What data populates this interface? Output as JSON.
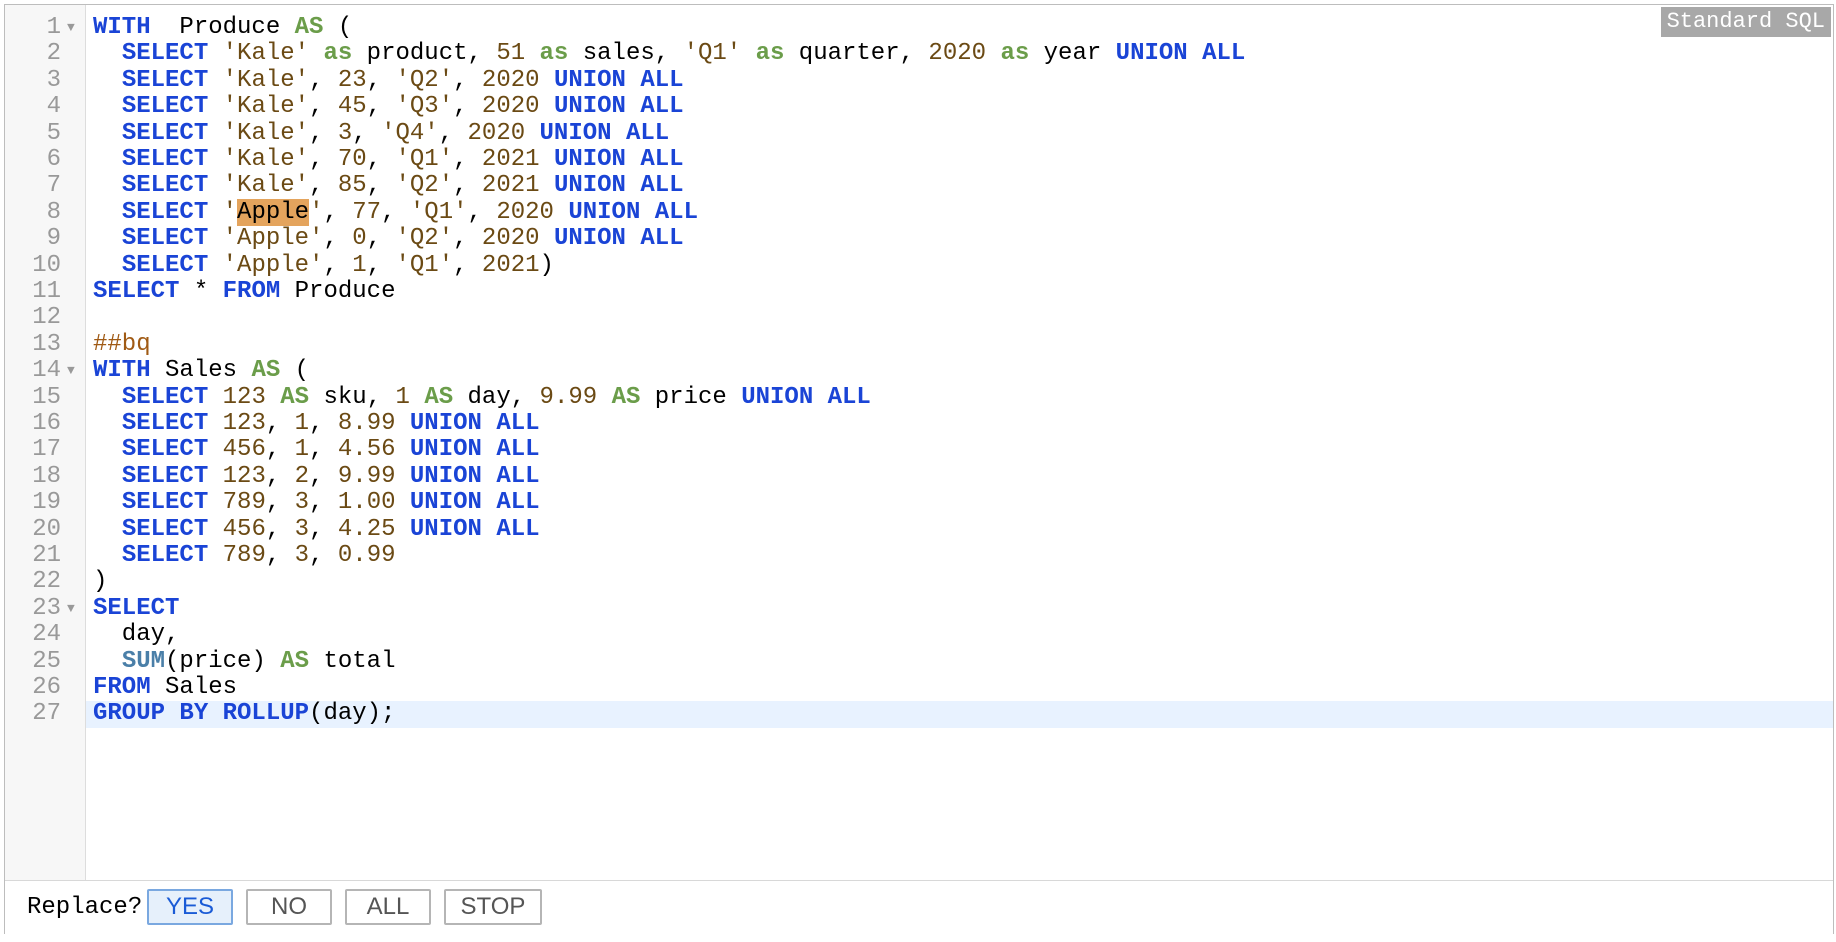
{
  "editor": {
    "dialect_label": "Standard SQL",
    "lines": [
      {
        "n": "1",
        "fold": true,
        "tokens": [
          [
            "kw",
            "WITH"
          ],
          [
            "",
            "  Produce "
          ],
          [
            "as",
            "AS"
          ],
          [
            "",
            " ("
          ]
        ]
      },
      {
        "n": "2",
        "tokens": [
          [
            "",
            "  "
          ],
          [
            "kw",
            "SELECT"
          ],
          [
            "",
            " "
          ],
          [
            "str",
            "'Kale'"
          ],
          [
            "",
            " "
          ],
          [
            "as",
            "as"
          ],
          [
            "",
            " product, "
          ],
          [
            "num",
            "51"
          ],
          [
            "",
            " "
          ],
          [
            "as",
            "as"
          ],
          [
            "",
            " sales, "
          ],
          [
            "str",
            "'Q1'"
          ],
          [
            "",
            " "
          ],
          [
            "as",
            "as"
          ],
          [
            "",
            " quarter, "
          ],
          [
            "num",
            "2020"
          ],
          [
            "",
            " "
          ],
          [
            "as",
            "as"
          ],
          [
            "",
            " year "
          ],
          [
            "kw",
            "UNION ALL"
          ]
        ]
      },
      {
        "n": "3",
        "tokens": [
          [
            "",
            "  "
          ],
          [
            "kw",
            "SELECT"
          ],
          [
            "",
            " "
          ],
          [
            "str",
            "'Kale'"
          ],
          [
            ", ",
            ", "
          ],
          [
            "num",
            "23"
          ],
          [
            ", ",
            ", "
          ],
          [
            "str",
            "'Q2'"
          ],
          [
            ", ",
            ", "
          ],
          [
            "num",
            "2020"
          ],
          [
            "",
            " "
          ],
          [
            "kw",
            "UNION ALL"
          ]
        ]
      },
      {
        "n": "4",
        "tokens": [
          [
            "",
            "  "
          ],
          [
            "kw",
            "SELECT"
          ],
          [
            "",
            " "
          ],
          [
            "str",
            "'Kale'"
          ],
          [
            ", ",
            ", "
          ],
          [
            "num",
            "45"
          ],
          [
            ", ",
            ", "
          ],
          [
            "str",
            "'Q3'"
          ],
          [
            ", ",
            ", "
          ],
          [
            "num",
            "2020"
          ],
          [
            "",
            " "
          ],
          [
            "kw",
            "UNION ALL"
          ]
        ]
      },
      {
        "n": "5",
        "tokens": [
          [
            "",
            "  "
          ],
          [
            "kw",
            "SELECT"
          ],
          [
            "",
            " "
          ],
          [
            "str",
            "'Kale'"
          ],
          [
            ", ",
            ", "
          ],
          [
            "num",
            "3"
          ],
          [
            ", ",
            ", "
          ],
          [
            "str",
            "'Q4'"
          ],
          [
            ", ",
            ", "
          ],
          [
            "num",
            "2020"
          ],
          [
            "",
            " "
          ],
          [
            "kw",
            "UNION ALL"
          ]
        ]
      },
      {
        "n": "6",
        "tokens": [
          [
            "",
            "  "
          ],
          [
            "kw",
            "SELECT"
          ],
          [
            "",
            " "
          ],
          [
            "str",
            "'Kale'"
          ],
          [
            ", ",
            ", "
          ],
          [
            "num",
            "70"
          ],
          [
            ", ",
            ", "
          ],
          [
            "str",
            "'Q1'"
          ],
          [
            ", ",
            ", "
          ],
          [
            "num",
            "2021"
          ],
          [
            "",
            " "
          ],
          [
            "kw",
            "UNION ALL"
          ]
        ]
      },
      {
        "n": "7",
        "tokens": [
          [
            "",
            "  "
          ],
          [
            "kw",
            "SELECT"
          ],
          [
            "",
            " "
          ],
          [
            "str",
            "'Kale'"
          ],
          [
            ", ",
            ", "
          ],
          [
            "num",
            "85"
          ],
          [
            ", ",
            ", "
          ],
          [
            "str",
            "'Q2'"
          ],
          [
            ", ",
            ", "
          ],
          [
            "num",
            "2021"
          ],
          [
            "",
            " "
          ],
          [
            "kw",
            "UNION ALL"
          ]
        ]
      },
      {
        "n": "8",
        "tokens": [
          [
            "",
            "  "
          ],
          [
            "kw",
            "SELECT"
          ],
          [
            "",
            " "
          ],
          [
            "str",
            "'"
          ],
          [
            "hl",
            "Apple"
          ],
          [
            "str",
            "'"
          ],
          [
            ", ",
            ", "
          ],
          [
            "num",
            "77"
          ],
          [
            ", ",
            ", "
          ],
          [
            "str",
            "'Q1'"
          ],
          [
            ", ",
            ", "
          ],
          [
            "num",
            "2020"
          ],
          [
            "",
            " "
          ],
          [
            "kw",
            "UNION ALL"
          ]
        ]
      },
      {
        "n": "9",
        "tokens": [
          [
            "",
            "  "
          ],
          [
            "kw",
            "SELECT"
          ],
          [
            "",
            " "
          ],
          [
            "str",
            "'Apple'"
          ],
          [
            ", ",
            ", "
          ],
          [
            "num",
            "0"
          ],
          [
            ", ",
            ", "
          ],
          [
            "str",
            "'Q2'"
          ],
          [
            ", ",
            ", "
          ],
          [
            "num",
            "2020"
          ],
          [
            "",
            " "
          ],
          [
            "kw",
            "UNION ALL"
          ]
        ]
      },
      {
        "n": "10",
        "tokens": [
          [
            "",
            "  "
          ],
          [
            "kw",
            "SELECT"
          ],
          [
            "",
            " "
          ],
          [
            "str",
            "'Apple'"
          ],
          [
            ", ",
            ", "
          ],
          [
            "num",
            "1"
          ],
          [
            ", ",
            ", "
          ],
          [
            "str",
            "'Q1'"
          ],
          [
            ", ",
            ", "
          ],
          [
            "num",
            "2021"
          ],
          [
            "",
            ")"
          ]
        ]
      },
      {
        "n": "11",
        "tokens": [
          [
            "kw",
            "SELECT"
          ],
          [
            "",
            " * "
          ],
          [
            "kw",
            "FROM"
          ],
          [
            "",
            " Produce"
          ]
        ]
      },
      {
        "n": "12",
        "tokens": []
      },
      {
        "n": "13",
        "tokens": [
          [
            "com",
            "##bq"
          ]
        ]
      },
      {
        "n": "14",
        "fold": true,
        "tokens": [
          [
            "kw",
            "WITH"
          ],
          [
            "",
            " Sales "
          ],
          [
            "as",
            "AS"
          ],
          [
            "",
            " ("
          ]
        ]
      },
      {
        "n": "15",
        "tokens": [
          [
            "",
            "  "
          ],
          [
            "kw",
            "SELECT"
          ],
          [
            "",
            " "
          ],
          [
            "num",
            "123"
          ],
          [
            "",
            " "
          ],
          [
            "as",
            "AS"
          ],
          [
            "",
            " sku, "
          ],
          [
            "num",
            "1"
          ],
          [
            "",
            " "
          ],
          [
            "as",
            "AS"
          ],
          [
            "",
            " day, "
          ],
          [
            "num",
            "9.99"
          ],
          [
            "",
            " "
          ],
          [
            "as",
            "AS"
          ],
          [
            "",
            " price "
          ],
          [
            "kw",
            "UNION ALL"
          ]
        ]
      },
      {
        "n": "16",
        "tokens": [
          [
            "",
            "  "
          ],
          [
            "kw",
            "SELECT"
          ],
          [
            "",
            " "
          ],
          [
            "num",
            "123"
          ],
          [
            ", ",
            ", "
          ],
          [
            "num",
            "1"
          ],
          [
            ", ",
            ", "
          ],
          [
            "num",
            "8.99"
          ],
          [
            "",
            " "
          ],
          [
            "kw",
            "UNION ALL"
          ]
        ]
      },
      {
        "n": "17",
        "tokens": [
          [
            "",
            "  "
          ],
          [
            "kw",
            "SELECT"
          ],
          [
            "",
            " "
          ],
          [
            "num",
            "456"
          ],
          [
            ", ",
            ", "
          ],
          [
            "num",
            "1"
          ],
          [
            ", ",
            ", "
          ],
          [
            "num",
            "4.56"
          ],
          [
            "",
            " "
          ],
          [
            "kw",
            "UNION ALL"
          ]
        ]
      },
      {
        "n": "18",
        "tokens": [
          [
            "",
            "  "
          ],
          [
            "kw",
            "SELECT"
          ],
          [
            "",
            " "
          ],
          [
            "num",
            "123"
          ],
          [
            ", ",
            ", "
          ],
          [
            "num",
            "2"
          ],
          [
            ", ",
            ", "
          ],
          [
            "num",
            "9.99"
          ],
          [
            "",
            " "
          ],
          [
            "kw",
            "UNION ALL"
          ]
        ]
      },
      {
        "n": "19",
        "tokens": [
          [
            "",
            "  "
          ],
          [
            "kw",
            "SELECT"
          ],
          [
            "",
            " "
          ],
          [
            "num",
            "789"
          ],
          [
            ", ",
            ", "
          ],
          [
            "num",
            "3"
          ],
          [
            ", ",
            ", "
          ],
          [
            "num",
            "1.00"
          ],
          [
            "",
            " "
          ],
          [
            "kw",
            "UNION ALL"
          ]
        ]
      },
      {
        "n": "20",
        "tokens": [
          [
            "",
            "  "
          ],
          [
            "kw",
            "SELECT"
          ],
          [
            "",
            " "
          ],
          [
            "num",
            "456"
          ],
          [
            ", ",
            ", "
          ],
          [
            "num",
            "3"
          ],
          [
            ", ",
            ", "
          ],
          [
            "num",
            "4.25"
          ],
          [
            "",
            " "
          ],
          [
            "kw",
            "UNION ALL"
          ]
        ]
      },
      {
        "n": "21",
        "tokens": [
          [
            "",
            "  "
          ],
          [
            "kw",
            "SELECT"
          ],
          [
            "",
            " "
          ],
          [
            "num",
            "789"
          ],
          [
            ", ",
            ", "
          ],
          [
            "num",
            "3"
          ],
          [
            ", ",
            ", "
          ],
          [
            "num",
            "0.99"
          ]
        ]
      },
      {
        "n": "22",
        "tokens": [
          [
            "",
            ")"
          ]
        ]
      },
      {
        "n": "23",
        "fold": true,
        "tokens": [
          [
            "kw",
            "SELECT"
          ]
        ]
      },
      {
        "n": "24",
        "tokens": [
          [
            "",
            "  day,"
          ]
        ]
      },
      {
        "n": "25",
        "tokens": [
          [
            "",
            "  "
          ],
          [
            "fn",
            "SUM"
          ],
          [
            "",
            "(price) "
          ],
          [
            "as",
            "AS"
          ],
          [
            "",
            " total"
          ]
        ]
      },
      {
        "n": "26",
        "tokens": [
          [
            "kw",
            "FROM"
          ],
          [
            "",
            " Sales"
          ]
        ]
      },
      {
        "n": "27",
        "active": true,
        "tokens": [
          [
            "kw",
            "GROUP BY"
          ],
          [
            "",
            " "
          ],
          [
            "kw",
            "ROLLUP"
          ],
          [
            "",
            "(day);"
          ]
        ]
      }
    ]
  },
  "replace_dialog": {
    "label": "Replace?",
    "buttons": [
      "YES",
      "NO",
      "ALL",
      "STOP"
    ]
  }
}
